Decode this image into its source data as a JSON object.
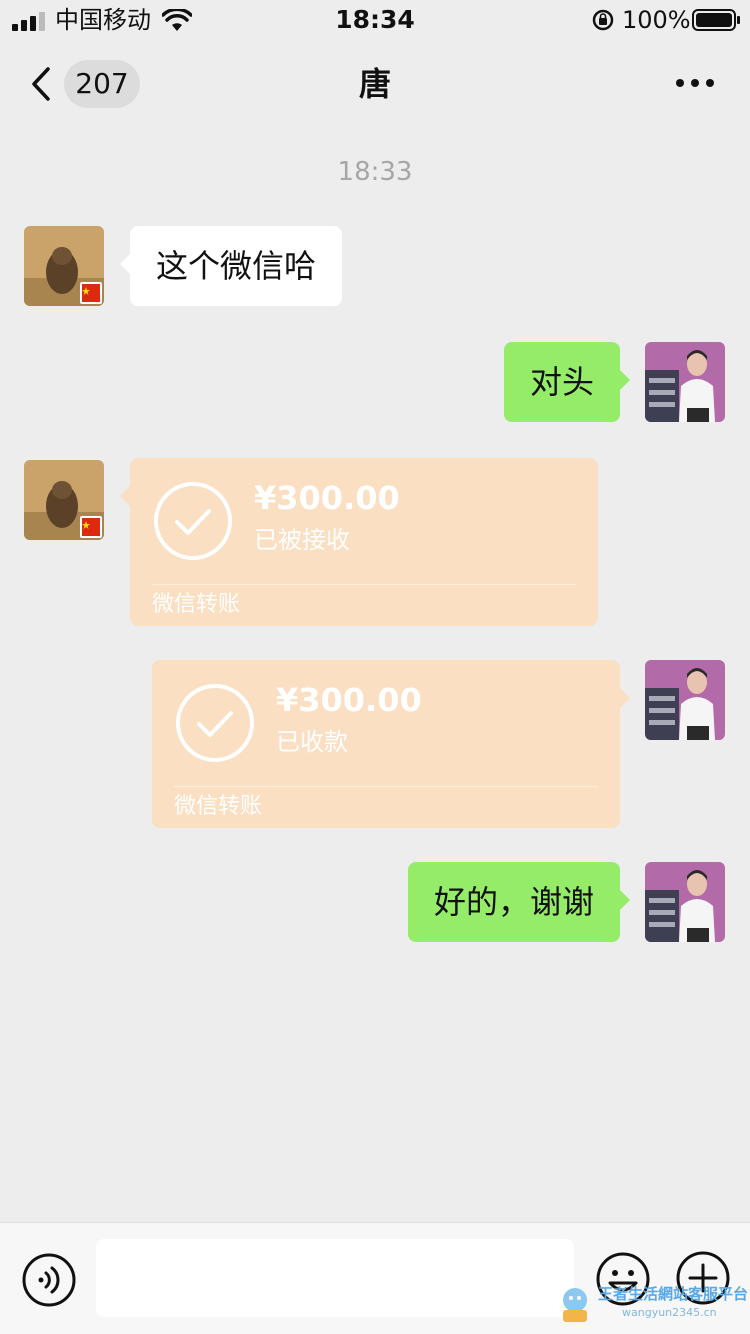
{
  "status_bar": {
    "carrier": "中国移动",
    "time": "18:34",
    "battery": "100%"
  },
  "nav": {
    "unread_count": "207",
    "title": "唐"
  },
  "chat": {
    "timestamp": "18:33",
    "messages": [
      {
        "side": "left",
        "type": "text",
        "text": "这个微信哈"
      },
      {
        "side": "right",
        "type": "text",
        "text": "对头"
      },
      {
        "side": "left",
        "type": "transfer",
        "amount": "¥300.00",
        "status": "已被接收",
        "label": "微信转账"
      },
      {
        "side": "right",
        "type": "transfer",
        "amount": "¥300.00",
        "status": "已收款",
        "label": "微信转账"
      },
      {
        "side": "right",
        "type": "text",
        "text": "好的，谢谢"
      }
    ]
  },
  "input_bar": {
    "placeholder": ""
  },
  "watermark": {
    "title": "王者生活網站客服平台",
    "url": "wangyun2345.cn"
  },
  "colors": {
    "background": "#ededed",
    "self_bubble": "#95ec69",
    "other_bubble": "#ffffff",
    "transfer_card": "#fbdfc2",
    "timestamp": "#a6a6a6"
  },
  "icons": [
    "signal-icon",
    "wifi-icon",
    "orientation-lock-icon",
    "battery-icon",
    "back-chevron-icon",
    "more-icon",
    "check-circle-icon",
    "voice-icon",
    "emoji-icon",
    "plus-icon",
    "flag-icon"
  ]
}
